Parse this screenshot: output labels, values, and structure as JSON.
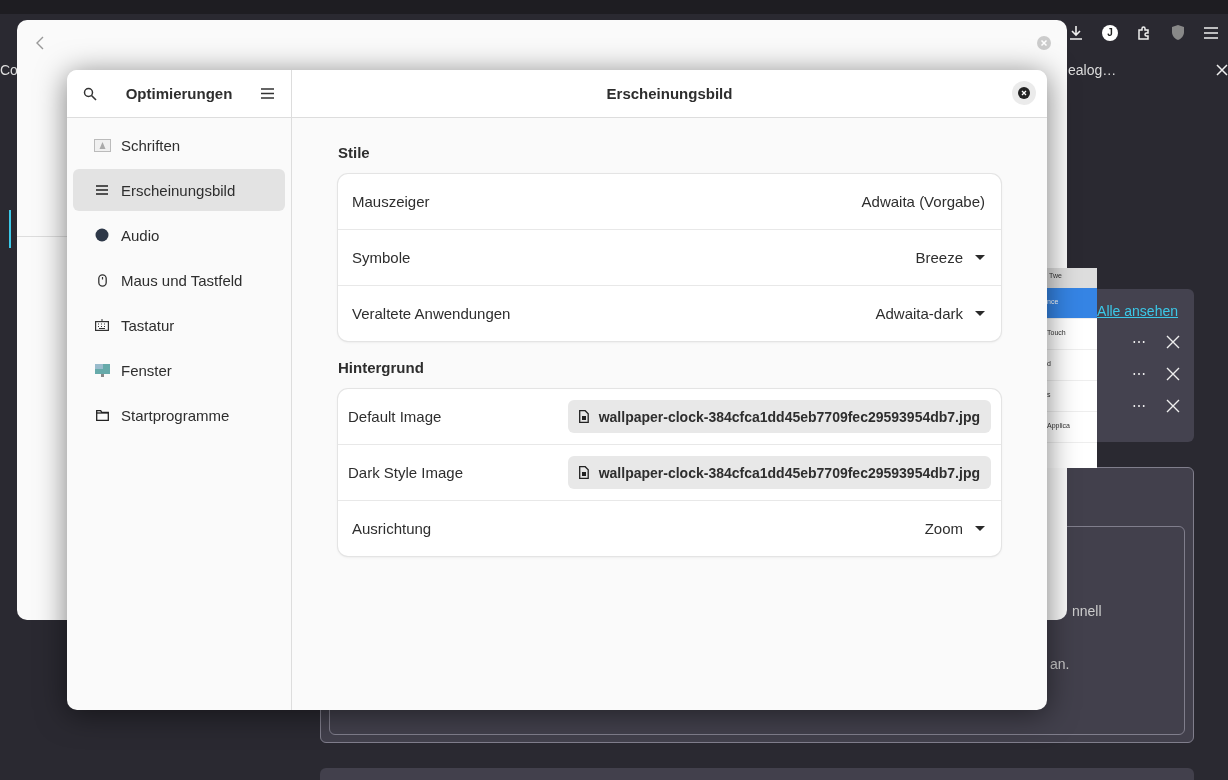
{
  "browser": {
    "avatar": "J",
    "fragment_left": "Co",
    "fragment_right": "ealog…"
  },
  "notifications": {
    "link": "Alle ansehen",
    "rows": [
      {
        "more": "⋯"
      },
      {
        "more": "⋯"
      },
      {
        "more": "⋯"
      }
    ]
  },
  "background_texts": [
    "nnell",
    "an."
  ],
  "thumbnail": {
    "tab": "Twe",
    "rows": [
      {
        "label": "nce",
        "selected": true
      },
      {
        "label": "Touch",
        "selected": false
      },
      {
        "label": "d",
        "selected": false
      },
      {
        "label": "s",
        "selected": false
      },
      {
        "label": "Applica",
        "selected": false
      }
    ]
  },
  "window": {
    "sidebar_title": "Optimierungen",
    "title": "Erscheinungsbild",
    "sidebar": [
      {
        "label": "Schriften",
        "selected": false
      },
      {
        "label": "Erscheinungsbild",
        "selected": true
      },
      {
        "label": "Audio",
        "selected": false
      },
      {
        "label": "Maus und Tastfeld",
        "selected": false
      },
      {
        "label": "Tastatur",
        "selected": false
      },
      {
        "label": "Fenster",
        "selected": false
      },
      {
        "label": "Startprogramme",
        "selected": false
      }
    ],
    "sections": [
      {
        "title": "Stile",
        "rows": [
          {
            "label": "Mauszeiger",
            "value": "Adwaita (Vorgabe)",
            "kind": "text"
          },
          {
            "label": "Symbole",
            "value": "Breeze",
            "kind": "dropdown"
          },
          {
            "label": "Veraltete Anwendungen",
            "value": "Adwaita-dark",
            "kind": "dropdown"
          }
        ]
      },
      {
        "title": "Hintergrund",
        "rows": [
          {
            "label": "Default Image",
            "value": "wallpaper-clock-384cfca1dd45eb7709fec29593954db7.jpg",
            "kind": "file"
          },
          {
            "label": "Dark Style Image",
            "value": "wallpaper-clock-384cfca1dd45eb7709fec29593954db7.jpg",
            "kind": "file"
          },
          {
            "label": "Ausrichtung",
            "value": "Zoom",
            "kind": "dropdown"
          }
        ]
      }
    ]
  }
}
